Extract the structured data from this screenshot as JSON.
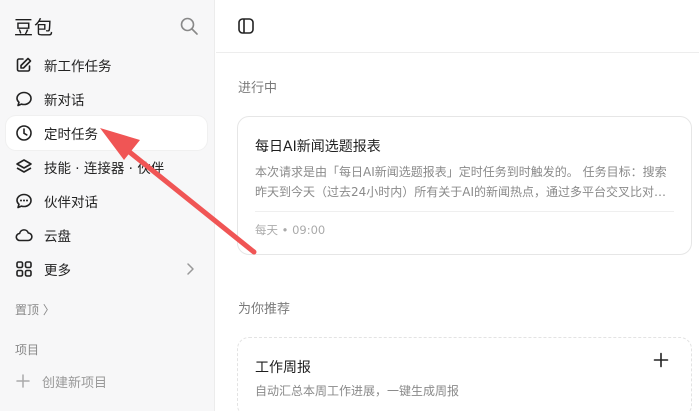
{
  "sidebar": {
    "brand": "豆包",
    "items": [
      {
        "label": "新工作任务",
        "icon": "edit-icon"
      },
      {
        "label": "新对话",
        "icon": "chat-bubble-icon"
      },
      {
        "label": "定时任务",
        "icon": "clock-icon"
      },
      {
        "label": "技能 · 连接器 · 伙伴",
        "icon": "layers-icon"
      },
      {
        "label": "伙伴对话",
        "icon": "chat-dots-icon"
      },
      {
        "label": "云盘",
        "icon": "cloud-icon"
      },
      {
        "label": "更多",
        "icon": "grid-icon"
      }
    ],
    "pinned_label": "置顶 〉",
    "projects_label": "项目",
    "new_project_label": "创建新项目"
  },
  "main": {
    "in_progress_heading": "进行中",
    "task_card": {
      "title": "每日AI新闻选题报表",
      "desc_line1": "本次请求是由「每日AI新闻选题报表」定时任务到时触发的。 任务目标：搜索",
      "desc_line2": "昨天到今天（过去24小时内）所有关于AI的新闻热点，通过多平台交叉比对分…",
      "schedule": "每天 • 09:00"
    },
    "recommend_heading": "为你推荐",
    "recommend_card": {
      "title": "工作周报",
      "desc": "自动汇总本周工作进展，一键生成周报"
    }
  },
  "colors": {
    "annotation_arrow": "#f05555",
    "sidebar_bg": "#f7f7f8"
  }
}
